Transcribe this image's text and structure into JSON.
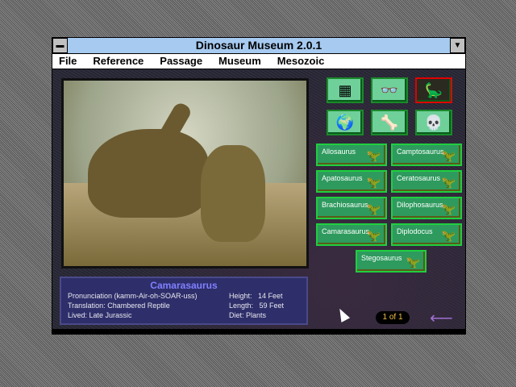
{
  "window": {
    "title": "Dinosaur Museum 2.0.1",
    "system_menu_icon": "minus-icon",
    "scroll_icon": "down-arrow-icon"
  },
  "menu": [
    "File",
    "Reference",
    "Passage",
    "Museum",
    "Mesozoic"
  ],
  "icon_buttons": [
    {
      "name": "control-panel",
      "icon": "control-panel-icon",
      "glyph": "▦"
    },
    {
      "name": "3d-glasses",
      "icon": "3d-glasses-icon",
      "glyph": "👓"
    },
    {
      "name": "diorama",
      "icon": "diorama-icon",
      "glyph": "🦕",
      "selected": true
    },
    {
      "name": "globe",
      "icon": "globe-icon",
      "glyph": "🌍"
    },
    {
      "name": "skeleton",
      "icon": "skeleton-icon",
      "glyph": "🦴"
    },
    {
      "name": "skull",
      "icon": "skull-icon",
      "glyph": "💀"
    }
  ],
  "dinosaurs": [
    {
      "label": "Allosaurus",
      "color": "#e02030"
    },
    {
      "label": "Camptosaurus",
      "color": "#b02070"
    },
    {
      "label": "Apatosaurus",
      "color": "#3040e0"
    },
    {
      "label": "Ceratosaurus",
      "color": "#e02030"
    },
    {
      "label": "Brachiosaurus",
      "color": "#3030d0"
    },
    {
      "label": "Dilophosaurus",
      "color": "#c02050"
    },
    {
      "label": "Camarasaurus",
      "color": "#2040e0"
    },
    {
      "label": "Diplodocus",
      "color": "#3040e0"
    },
    {
      "label": "Stegosaurus",
      "color": "#e0f020"
    }
  ],
  "info": {
    "name": "Camarasaurus",
    "pronunciation": "Pronunciation (kamm-Air-oh-SOAR-uss)",
    "translation": "Translation: Chambered Reptile",
    "lived": "Lived: Late Jurassic",
    "height": "Height:   14 Feet",
    "length": "Length:   59 Feet",
    "diet": "Diet: Plants"
  },
  "pager": "1 of 1",
  "back_icon": "back-arrow-icon"
}
